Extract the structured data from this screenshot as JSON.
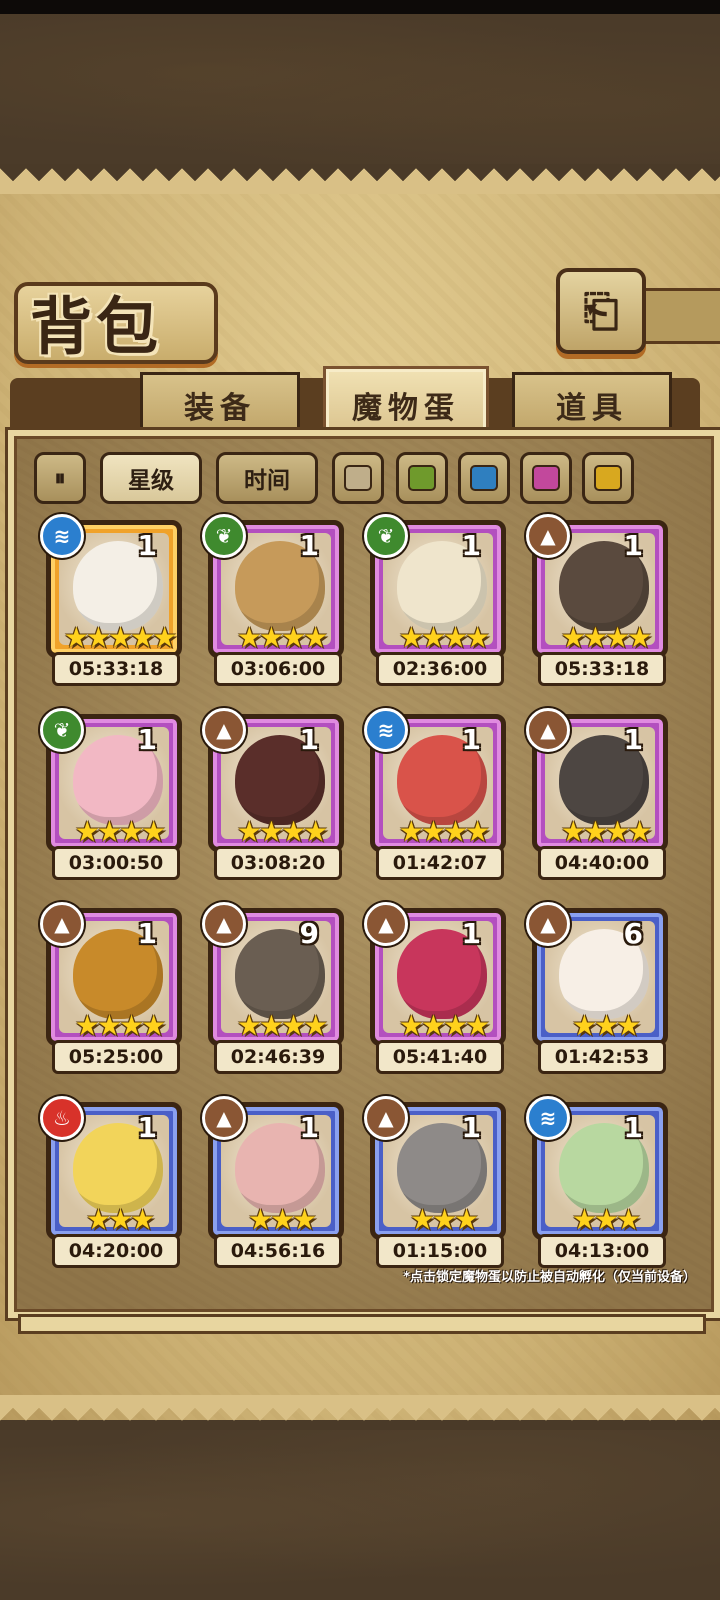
{
  "title": "背包",
  "back_icon": "back-arrow-icon",
  "tabs": [
    {
      "label": "装备",
      "active": false
    },
    {
      "label": "魔物蛋",
      "active": true
    },
    {
      "label": "道具",
      "active": false
    }
  ],
  "filters": {
    "toggle_icon": "pause-toggle-icon",
    "sort_star": "星级",
    "sort_time": "时间",
    "colors": [
      "#bfae8a",
      "#6f9a2c",
      "#2f7fbf",
      "#c2489c",
      "#d8a81f"
    ]
  },
  "eggs": [
    {
      "element": "water",
      "count": "1",
      "stars": "★★★★★",
      "timer": "05:33:18",
      "frame": "gold",
      "color": "#f4efe6"
    },
    {
      "element": "wood",
      "count": "1",
      "stars": "★★★★",
      "timer": "03:06:00",
      "frame": "purple",
      "color": "#c69a5a"
    },
    {
      "element": "wood",
      "count": "1",
      "stars": "★★★★",
      "timer": "02:36:00",
      "frame": "purple",
      "color": "#efe5cc"
    },
    {
      "element": "earth",
      "count": "1",
      "stars": "★★★★",
      "timer": "05:33:18",
      "frame": "purple",
      "color": "#5a4a3e"
    },
    {
      "element": "wood",
      "count": "1",
      "stars": "★★★★",
      "timer": "03:00:50",
      "frame": "purple",
      "color": "#f2b8c4"
    },
    {
      "element": "earth",
      "count": "1",
      "stars": "★★★★",
      "timer": "03:08:20",
      "frame": "purple",
      "color": "#5a2e2a"
    },
    {
      "element": "water",
      "count": "1",
      "stars": "★★★★",
      "timer": "01:42:07",
      "frame": "purple",
      "color": "#d9534a"
    },
    {
      "element": "earth",
      "count": "1",
      "stars": "★★★★",
      "timer": "04:40:00",
      "frame": "purple",
      "color": "#4d4642"
    },
    {
      "element": "earth",
      "count": "1",
      "stars": "★★★★",
      "timer": "05:25:00",
      "frame": "purple",
      "color": "#c88a2a"
    },
    {
      "element": "earth",
      "count": "9",
      "stars": "★★★★",
      "timer": "02:46:39",
      "frame": "purple",
      "color": "#6a5e52"
    },
    {
      "element": "earth",
      "count": "1",
      "stars": "★★★★",
      "timer": "05:41:40",
      "frame": "purple",
      "color": "#c8365c"
    },
    {
      "element": "earth",
      "count": "6",
      "stars": "★★★",
      "timer": "01:42:53",
      "frame": "blue",
      "color": "#f7efe6"
    },
    {
      "element": "fire",
      "count": "1",
      "stars": "★★★",
      "timer": "04:20:00",
      "frame": "blue",
      "color": "#f2d45a"
    },
    {
      "element": "earth",
      "count": "1",
      "stars": "★★★",
      "timer": "04:56:16",
      "frame": "blue",
      "color": "#e8b4b0"
    },
    {
      "element": "earth",
      "count": "1",
      "stars": "★★★",
      "timer": "01:15:00",
      "frame": "blue",
      "color": "#8e8a88"
    },
    {
      "element": "water",
      "count": "1",
      "stars": "★★★",
      "timer": "04:13:00",
      "frame": "blue",
      "color": "#b8d8a0"
    }
  ],
  "footnote": "*点击锁定魔物蛋以防止被自动孵化（仅当前设备）"
}
